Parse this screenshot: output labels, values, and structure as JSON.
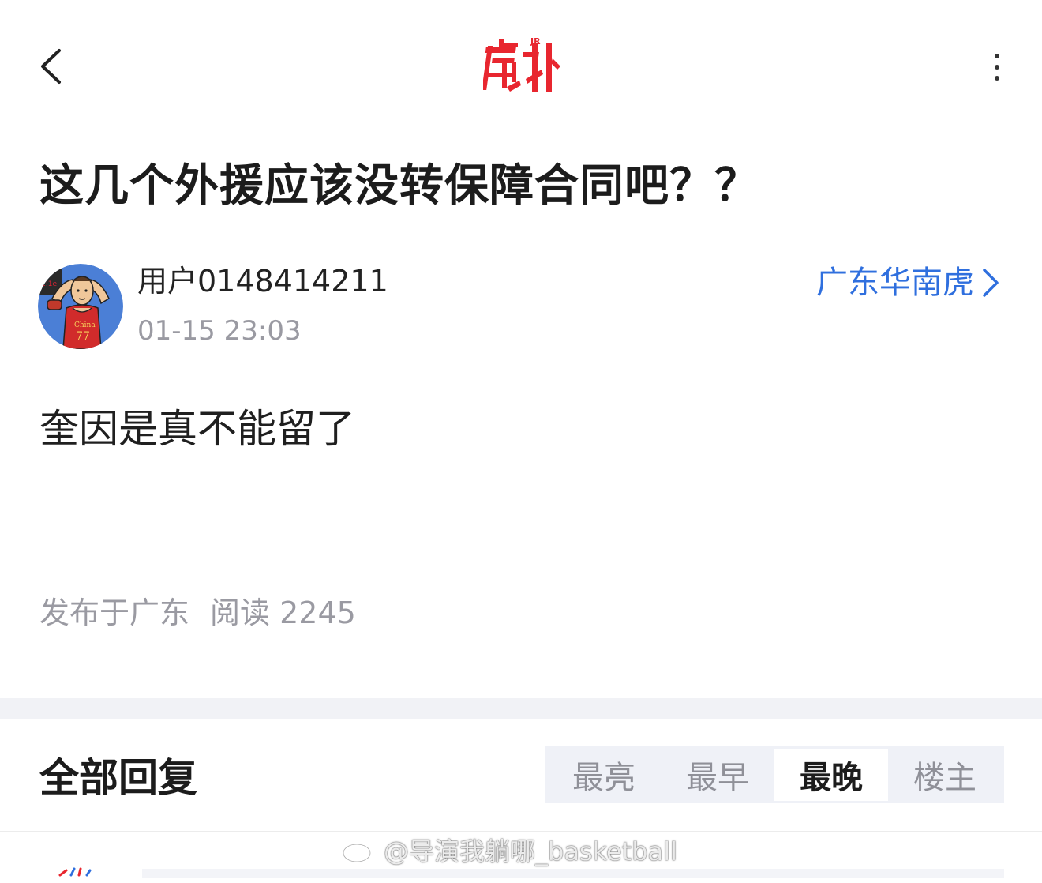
{
  "header": {
    "logo_text": "虎扑",
    "logo_badge": "JR"
  },
  "post": {
    "title": "这几个外援应该没转保障合同吧？？",
    "author": "用户0148414211",
    "time": "01-15 23:03",
    "board": "广东华南虎",
    "body": "奎因是真不能留了",
    "location": "发布于广东",
    "reads_label": "阅读 2245",
    "avatar_jersey_text": "China",
    "avatar_jersey_number": "77"
  },
  "replies": {
    "title": "全部回复",
    "sort_tabs": [
      "最亮",
      "最早",
      "最晚",
      "楼主"
    ],
    "active_tab": "最晚"
  },
  "watermark": {
    "text": "@导演我躺哪_basketball"
  },
  "colors": {
    "brand_red": "#e8262f",
    "link_blue": "#2f6fde",
    "meta_gray": "#9a9aa2",
    "tab_bg": "#eff1f7",
    "section_gap": "#f1f2f6"
  }
}
